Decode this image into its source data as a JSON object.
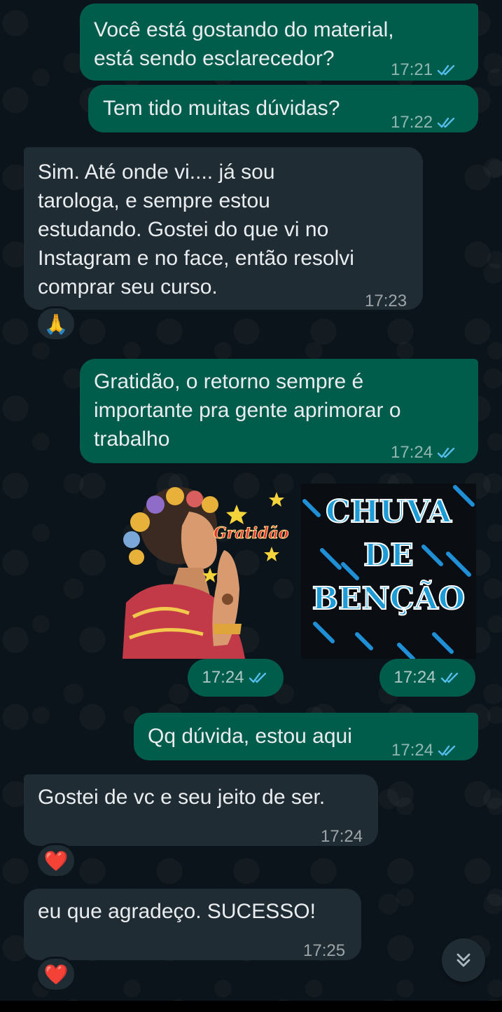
{
  "colors": {
    "background": "#0b141a",
    "outgoing_bubble": "#005c4b",
    "incoming_bubble": "#202c33",
    "read_ticks": "#53bdeb"
  },
  "messages": [
    {
      "direction": "outgoing",
      "text": "Você está gostando do material,\nestá sendo esclarecedor?",
      "time": "17:21",
      "status": "read"
    },
    {
      "direction": "outgoing",
      "text": "Tem tido muitas dúvidas?",
      "time": "17:22",
      "status": "read"
    },
    {
      "direction": "incoming",
      "text": "Sim. Até onde vi.... já sou\ntarologa, e sempre estou\nestudando. Gostei do que vi no\nInstagram e no face, então resolvi\ncomprar seu curso.",
      "time": "17:23",
      "reaction": "🙏"
    },
    {
      "direction": "outgoing",
      "text": "Gratidão, o retorno sempre é\nimportante pra gente aprimorar o\ntrabalho",
      "time": "17:24",
      "status": "read"
    },
    {
      "direction": "outgoing",
      "text": "Qq dúvida, estou aqui",
      "time": "17:24",
      "status": "read"
    },
    {
      "direction": "incoming",
      "text": "Gostei de vc e seu jeito de ser.",
      "time": "17:24",
      "reaction": "❤️"
    },
    {
      "direction": "incoming",
      "text": "eu que agradeço.  SUCESSO!",
      "time": "17:25",
      "reaction": "❤️"
    }
  ],
  "stickers": [
    {
      "caption": "Gratidão",
      "time": "17:24",
      "status": "read",
      "icon": "praying-woman-sticker"
    },
    {
      "caption_lines": [
        "CHUVA",
        "DE",
        "BENÇÃO"
      ],
      "time": "17:24",
      "status": "read",
      "icon": "rain-text-sticker"
    }
  ],
  "scroll_button": {
    "icon": "double-chevron-down-icon"
  }
}
